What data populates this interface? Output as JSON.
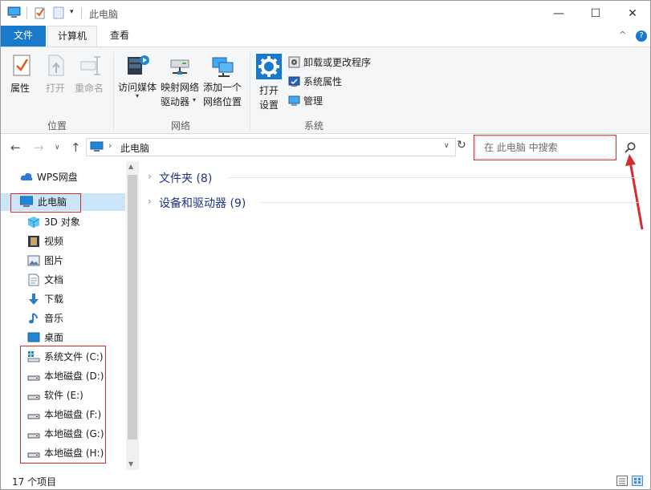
{
  "window": {
    "title": "此电脑",
    "minimize_glyph": "—",
    "maximize_glyph": "☐",
    "close_glyph": "✕"
  },
  "ribbon": {
    "tabs": [
      {
        "label": "文件"
      },
      {
        "label": "计算机"
      },
      {
        "label": "查看"
      }
    ],
    "collapse_glyph": "^",
    "help_glyph": "?",
    "groups": {
      "location": {
        "label": "位置",
        "properties": "属性",
        "open": "打开",
        "rename": "重命名"
      },
      "network": {
        "label": "网络",
        "media_line1": "访问媒体",
        "map_line1": "映射网络",
        "map_line2": "驱动器",
        "add_line1": "添加一个",
        "add_line2": "网络位置"
      },
      "system": {
        "label": "系统",
        "open_line1": "打开",
        "open_line2": "设置",
        "uninstall": "卸载或更改程序",
        "sysprops": "系统属性",
        "manage": "管理"
      }
    }
  },
  "address": {
    "path": "此电脑",
    "search_placeholder": "在 此电脑 中搜索"
  },
  "nav_pane": {
    "wps": "WPS网盘",
    "this_pc": "此电脑",
    "items": [
      {
        "label": "3D 对象",
        "icon": "cube-icon"
      },
      {
        "label": "视频",
        "icon": "video-icon"
      },
      {
        "label": "图片",
        "icon": "picture-icon"
      },
      {
        "label": "文档",
        "icon": "document-icon"
      },
      {
        "label": "下载",
        "icon": "download-icon"
      },
      {
        "label": "音乐",
        "icon": "music-icon"
      },
      {
        "label": "桌面",
        "icon": "desktop-icon"
      }
    ],
    "drives": [
      {
        "label": "系统文件 (C:)"
      },
      {
        "label": "本地磁盘 (D:)"
      },
      {
        "label": "软件 (E:)"
      },
      {
        "label": "本地磁盘 (F:)"
      },
      {
        "label": "本地磁盘 (G:)"
      },
      {
        "label": "本地磁盘 (H:)"
      }
    ]
  },
  "content": {
    "groups": [
      {
        "label": "文件夹 (8)"
      },
      {
        "label": "设备和驱动器 (9)"
      }
    ]
  },
  "status": {
    "items": "17 个项目"
  },
  "colors": {
    "accent": "#1979ca",
    "annotation": "#d52b2b"
  }
}
